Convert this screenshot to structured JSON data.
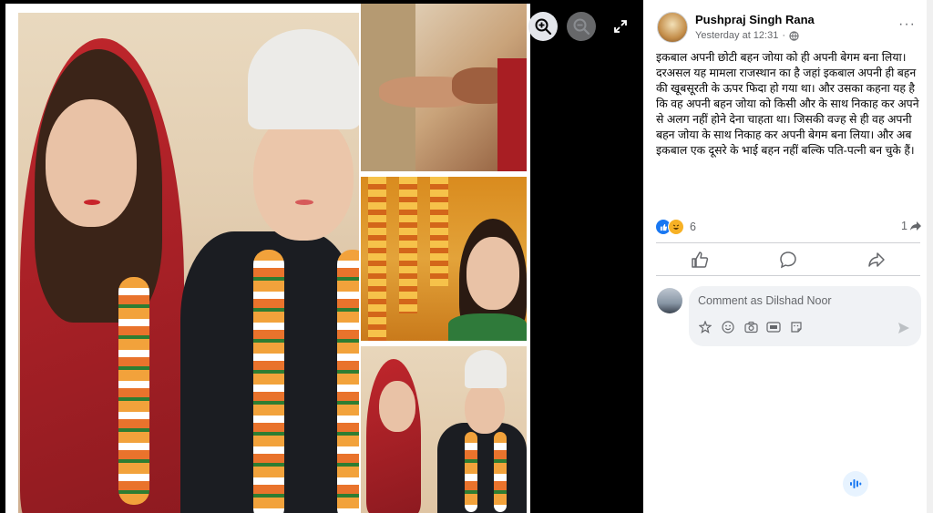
{
  "post": {
    "author": "Pushpraj Singh Rana",
    "timestamp": "Yesterday at 12:31",
    "privacy_dot": "·",
    "more_label": "···",
    "text": "इकबाल अपनी छोटी बहन जोया को ही अपनी बेगम बना लिया। दरअसल यह मामला राजस्थान का है जहां इकबाल अपनी ही बहन की खूबसूरती के ऊपर फिदा हो गया था। और उसका कहना यह है कि वह अपनी बहन जोया को किसी और के साथ निकाह कर अपने से अलग नहीं होने देना चाहता था। जिसकी वज्ह से ही वह अपनी बहन जोया के साथ निकाह कर अपनी बेगम बना लिया। और अब इकबाल एक दूसरे के भाई बहन नहीं बल्कि पति-पत्नी बन चुके हैं।",
    "reaction_count": "6",
    "share_count": "1"
  },
  "comment": {
    "placeholder": "Comment as Dilshad Noor"
  },
  "icons": {
    "zoom_in": "zoom-in-icon",
    "zoom_out": "zoom-out-icon",
    "expand": "expand-icon",
    "like": "like-icon",
    "comment": "comment-icon",
    "share": "share-icon",
    "globe": "globe-icon",
    "sticker": "sticker-icon",
    "emoji": "emoji-icon",
    "camera": "camera-icon",
    "gif": "gif-icon",
    "avatar_sticker": "avatar-sticker-icon",
    "send": "send-icon",
    "voice": "voice-icon"
  },
  "colors": {
    "facebook_blue": "#1877f2",
    "background_dark": "#000000",
    "secondary_text": "#65676b"
  }
}
